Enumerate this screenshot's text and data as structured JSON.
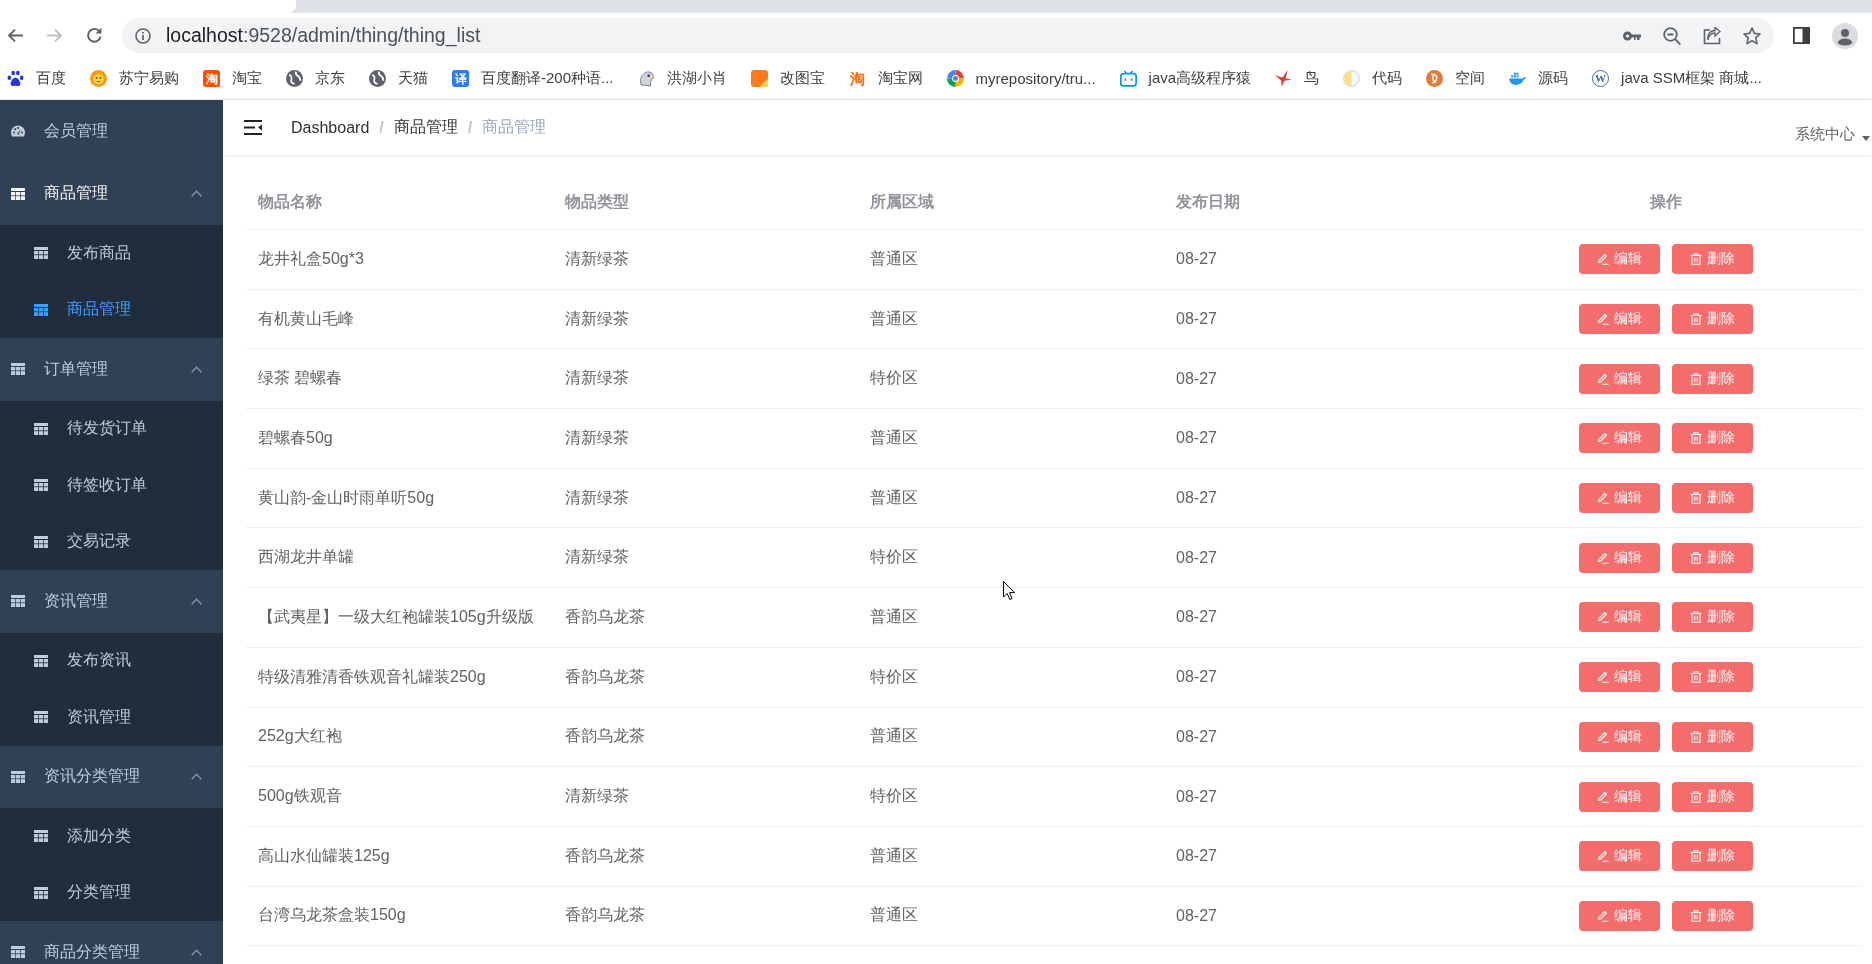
{
  "browser": {
    "back": {
      "disabled": false
    },
    "forward": {
      "disabled": true
    },
    "url": {
      "host": "localhost",
      "path": ":9528/admin/thing/thing_list"
    },
    "bookmarks": [
      {
        "label": "百度",
        "kind": "paw"
      },
      {
        "label": "苏宁易购",
        "kind": "lion"
      },
      {
        "label": "淘宝",
        "kind": "glyph-tile",
        "glyph": "淘",
        "color": "#ff5000"
      },
      {
        "label": "京东",
        "kind": "globe"
      },
      {
        "label": "天猫",
        "kind": "globe"
      },
      {
        "label": "百度翻译-200种语...",
        "kind": "glyph-tile",
        "glyph": "译",
        "color": "#2b7cf6"
      },
      {
        "label": "洪湖小肖",
        "kind": "mascot"
      },
      {
        "label": "改图宝",
        "kind": "square"
      },
      {
        "label": "淘宝网",
        "kind": "glyph",
        "glyph": "淘",
        "color": "#ff6a00"
      },
      {
        "label": "myrepository/tru...",
        "kind": "ring"
      },
      {
        "label": "java高级程序猿",
        "kind": "tv"
      },
      {
        "label": "鸟",
        "kind": "bird"
      },
      {
        "label": "代码",
        "kind": "half-circle"
      },
      {
        "label": "空间",
        "kind": "swirl"
      },
      {
        "label": "源码",
        "kind": "whale"
      },
      {
        "label": "java SSM框架 商城...",
        "kind": "letter-circle",
        "glyph": "W"
      }
    ]
  },
  "sidebar": {
    "menu": [
      {
        "kind": "link",
        "label": "会员管理",
        "selected": false
      },
      {
        "kind": "group",
        "label": "商品管理",
        "expanded": true,
        "children": [
          {
            "label": "发布商品",
            "selected": false
          },
          {
            "label": "商品管理",
            "selected": true
          }
        ]
      },
      {
        "kind": "group",
        "label": "订单管理",
        "expanded": true,
        "children": [
          {
            "label": "待发货订单",
            "selected": false
          },
          {
            "label": "待签收订单",
            "selected": false
          },
          {
            "label": "交易记录",
            "selected": false
          }
        ]
      },
      {
        "kind": "group",
        "label": "资讯管理",
        "expanded": true,
        "children": [
          {
            "label": "发布资讯",
            "selected": false
          },
          {
            "label": "资讯管理",
            "selected": false
          }
        ]
      },
      {
        "kind": "group",
        "label": "资讯分类管理",
        "expanded": true,
        "children": [
          {
            "label": "添加分类",
            "selected": false
          },
          {
            "label": "分类管理",
            "selected": false
          }
        ]
      },
      {
        "kind": "group",
        "label": "商品分类管理",
        "expanded": true
      }
    ]
  },
  "header": {
    "breadcrumb": [
      {
        "label": "Dashboard"
      },
      {
        "separator": "/",
        "label": "商品管理"
      },
      {
        "separator": "/",
        "label": "商品管理"
      }
    ],
    "user_menu": {
      "label": "系统中心"
    }
  },
  "table": {
    "columns": [
      "物品名称",
      "物品类型",
      "所属区域",
      "发布日期",
      "操作"
    ],
    "rows": [
      {
        "cells": [
          "龙井礼盒50g*3",
          "清新绿茶",
          "普通区",
          "08-27"
        ],
        "actions": [
          {
            "kind": "edit",
            "label": "编辑"
          },
          {
            "kind": "delete",
            "label": "删除"
          }
        ]
      },
      {
        "cells": [
          "有机黄山毛峰",
          "清新绿茶",
          "普通区",
          "08-27"
        ],
        "actions": [
          {
            "kind": "edit",
            "label": "编辑"
          },
          {
            "kind": "delete",
            "label": "删除"
          }
        ]
      },
      {
        "cells": [
          "绿茶 碧螺春",
          "清新绿茶",
          "特价区",
          "08-27"
        ],
        "actions": [
          {
            "kind": "edit",
            "label": "编辑"
          },
          {
            "kind": "delete",
            "label": "删除"
          }
        ]
      },
      {
        "cells": [
          "碧螺春50g",
          "清新绿茶",
          "普通区",
          "08-27"
        ],
        "actions": [
          {
            "kind": "edit",
            "label": "编辑"
          },
          {
            "kind": "delete",
            "label": "删除"
          }
        ]
      },
      {
        "cells": [
          "黄山韵-金山时雨单听50g",
          "清新绿茶",
          "普通区",
          "08-27"
        ],
        "actions": [
          {
            "kind": "edit",
            "label": "编辑"
          },
          {
            "kind": "delete",
            "label": "删除"
          }
        ]
      },
      {
        "cells": [
          "西湖龙井单罐",
          "清新绿茶",
          "特价区",
          "08-27"
        ],
        "actions": [
          {
            "kind": "edit",
            "label": "编辑"
          },
          {
            "kind": "delete",
            "label": "删除"
          }
        ]
      },
      {
        "cells": [
          "【武夷星】一级大红袍罐装105g升级版",
          "香韵乌龙茶",
          "普通区",
          "08-27"
        ],
        "actions": [
          {
            "kind": "edit",
            "label": "编辑"
          },
          {
            "kind": "delete",
            "label": "删除"
          }
        ]
      },
      {
        "cells": [
          "特级清雅清香铁观音礼罐装250g",
          "香韵乌龙茶",
          "特价区",
          "08-27"
        ],
        "actions": [
          {
            "kind": "edit",
            "label": "编辑"
          },
          {
            "kind": "delete",
            "label": "删除"
          }
        ]
      },
      {
        "cells": [
          "252g大红袍",
          "香韵乌龙茶",
          "普通区",
          "08-27"
        ],
        "actions": [
          {
            "kind": "edit",
            "label": "编辑"
          },
          {
            "kind": "delete",
            "label": "删除"
          }
        ]
      },
      {
        "cells": [
          "500g铁观音",
          "清新绿茶",
          "特价区",
          "08-27"
        ],
        "actions": [
          {
            "kind": "edit",
            "label": "编辑"
          },
          {
            "kind": "delete",
            "label": "删除"
          }
        ]
      },
      {
        "cells": [
          "高山水仙罐装125g",
          "香韵乌龙茶",
          "普通区",
          "08-27"
        ],
        "actions": [
          {
            "kind": "edit",
            "label": "编辑"
          },
          {
            "kind": "delete",
            "label": "删除"
          }
        ]
      },
      {
        "cells": [
          "台湾乌龙茶盒装150g",
          "香韵乌龙茶",
          "普通区",
          "08-27"
        ],
        "actions": [
          {
            "kind": "edit",
            "label": "编辑"
          },
          {
            "kind": "delete",
            "label": "删除"
          }
        ]
      }
    ]
  }
}
